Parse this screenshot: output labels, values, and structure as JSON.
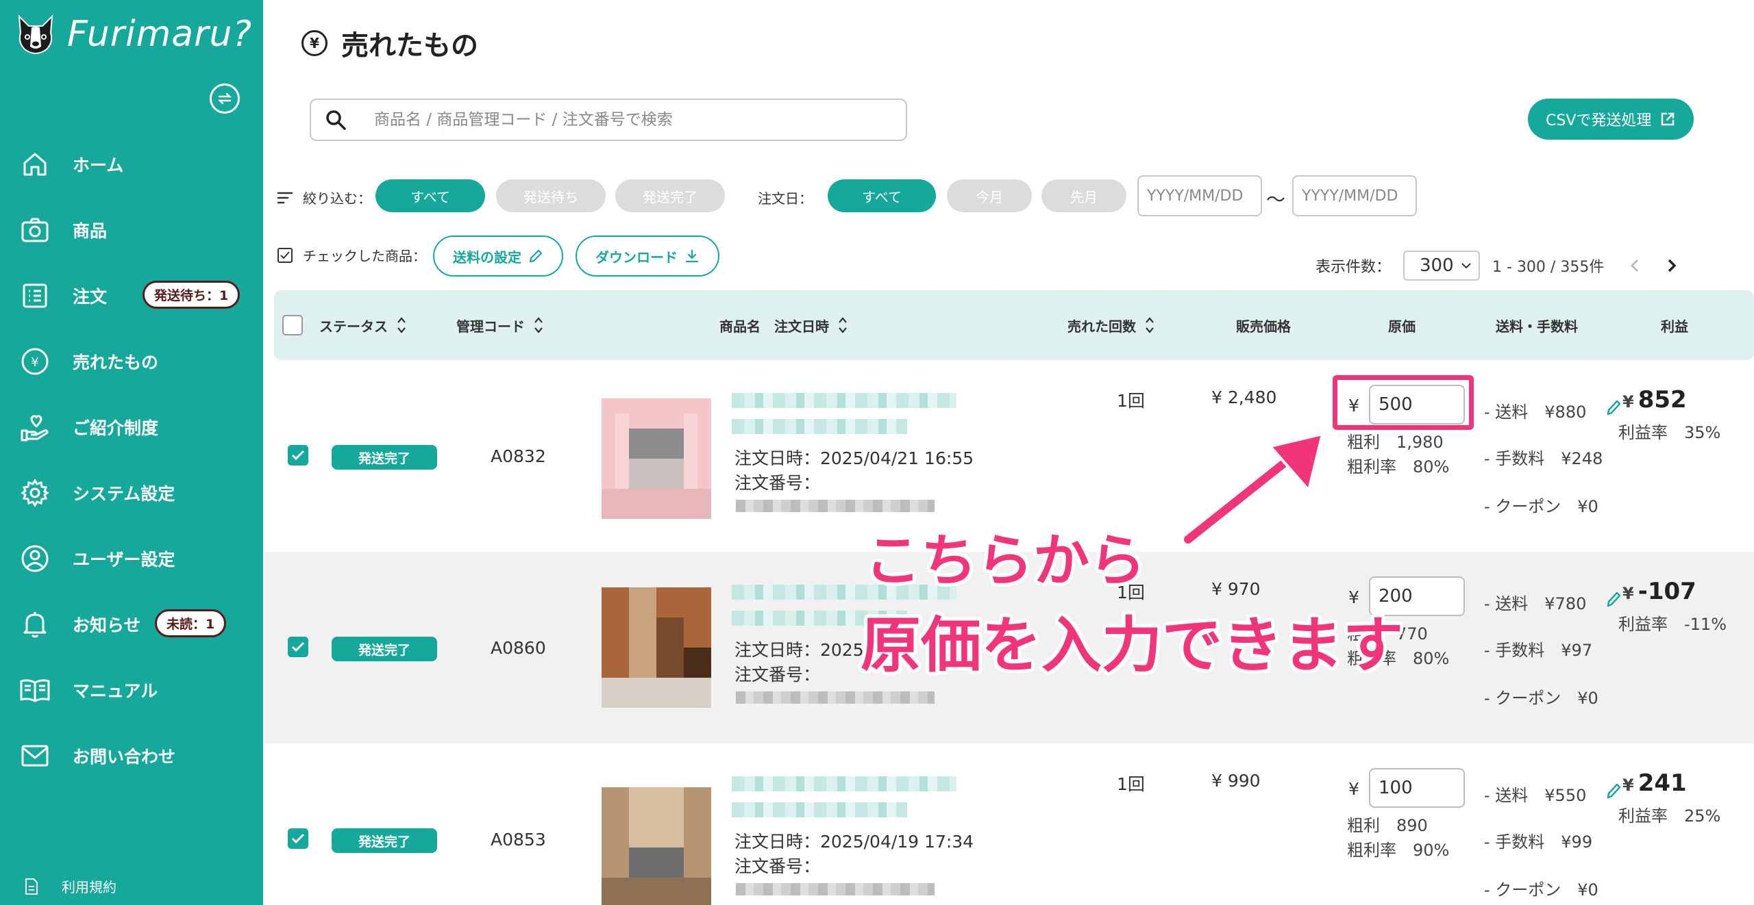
{
  "app": {
    "name": "Furimaru?"
  },
  "sidebar": {
    "items": [
      {
        "label": "ホーム",
        "icon": "home-icon"
      },
      {
        "label": "商品",
        "icon": "camera-icon"
      },
      {
        "label": "注文",
        "icon": "list-icon",
        "badge": "発送待ち：1"
      },
      {
        "label": "売れたもの",
        "icon": "yen-circle-icon"
      },
      {
        "label": "ご紹介制度",
        "icon": "hand-heart-icon"
      },
      {
        "label": "システム設定",
        "icon": "gear-icon"
      },
      {
        "label": "ユーザー設定",
        "icon": "user-icon"
      },
      {
        "label": "お知らせ",
        "icon": "bell-icon",
        "badge": "未読：1"
      },
      {
        "label": "マニュアル",
        "icon": "book-icon"
      },
      {
        "label": "お問い合わせ",
        "icon": "mail-icon"
      }
    ],
    "terms": "利用規約"
  },
  "page": {
    "title": "売れたもの",
    "search_placeholder": "商品名 / 商品管理コード / 注文番号で検索",
    "csv_button": "CSVで発送処理"
  },
  "filters": {
    "narrow_label": "絞り込む：",
    "status_options": [
      "すべて",
      "発送待ち",
      "発送完了"
    ],
    "status_selected": "すべて",
    "date_label": "注文日：",
    "date_options": [
      "すべて",
      "今月",
      "先月"
    ],
    "date_selected": "すべて",
    "date_from_placeholder": "YYYY/MM/DD",
    "date_to_placeholder": "YYYY/MM/DD",
    "date_sep": "〜"
  },
  "bulk": {
    "checked_label": "チェックした商品：",
    "shipping_button": "送料の設定",
    "download_button": "ダウンロード"
  },
  "pagination": {
    "per_page_label": "表示件数：",
    "per_page_value": "300",
    "range": "1 - 300 / 355件"
  },
  "table": {
    "headers": {
      "status": "ステータス",
      "code": "管理コード",
      "product": "商品名　注文日時",
      "times_sold": "売れた回数",
      "price": "販売価格",
      "cost": "原価",
      "fees": "送料・手数料",
      "profit": "利益"
    },
    "rows": [
      {
        "checked": true,
        "status": "発送完了",
        "code": "A0832",
        "order_date": "注文日時：2025/04/21 16:55",
        "order_no_label": "注文番号：",
        "times": "1回",
        "price": "¥ 2,480",
        "cost_currency": "¥",
        "cost": "500",
        "gross_profit": "粗利　1,980",
        "gross_margin": "粗利率　80%",
        "shipping": "- 送料　¥880",
        "fee": "- 手数料　¥248",
        "coupon": "- クーポン　¥0",
        "profit": "852",
        "profit_prefix": "¥",
        "profit_rate": "利益率　35%",
        "thumb_colors": [
          "#f4c6c8",
          "#c9c0bf",
          "#8d8d8d",
          "#e8b7ba"
        ]
      },
      {
        "checked": true,
        "status": "発送完了",
        "code": "A0860",
        "order_date": "注文日時：2025",
        "order_no_label": "注文番号：",
        "times": "1回",
        "price": "¥ 970",
        "cost_currency": "¥",
        "cost": "200",
        "gross_profit": "粗利　770",
        "gross_margin": "粗利率　80%",
        "shipping": "- 送料　¥780",
        "fee": "- 手数料　¥97",
        "coupon": "- クーポン　¥0",
        "profit": "-107",
        "profit_prefix": "¥",
        "profit_rate": "利益率　-11%",
        "thumb_colors": [
          "#a8663a",
          "#7a4a2c",
          "#c9a27f",
          "#4a2c1a"
        ]
      },
      {
        "checked": true,
        "status": "発送完了",
        "code": "A0853",
        "order_date": "注文日時：2025/04/19 17:34",
        "order_no_label": "注文番号：",
        "times": "1回",
        "price": "¥ 990",
        "cost_currency": "¥",
        "cost": "100",
        "gross_profit": "粗利　890",
        "gross_margin": "粗利率　90%",
        "shipping": "- 送料　¥550",
        "fee": "- 手数料　¥99",
        "coupon": "- クーポン　¥0",
        "profit": "241",
        "profit_prefix": "¥",
        "profit_rate": "利益率　25%",
        "thumb_colors": [
          "#b89572",
          "#8e7055",
          "#d6bea0",
          "#6d6d6d"
        ]
      }
    ]
  },
  "annotation": {
    "line1": "こちらから",
    "line2": "原価を入力できます",
    "color": "#f0357a"
  },
  "colors": {
    "accent": "#16a89b",
    "header_bg": "#dff1ef"
  }
}
